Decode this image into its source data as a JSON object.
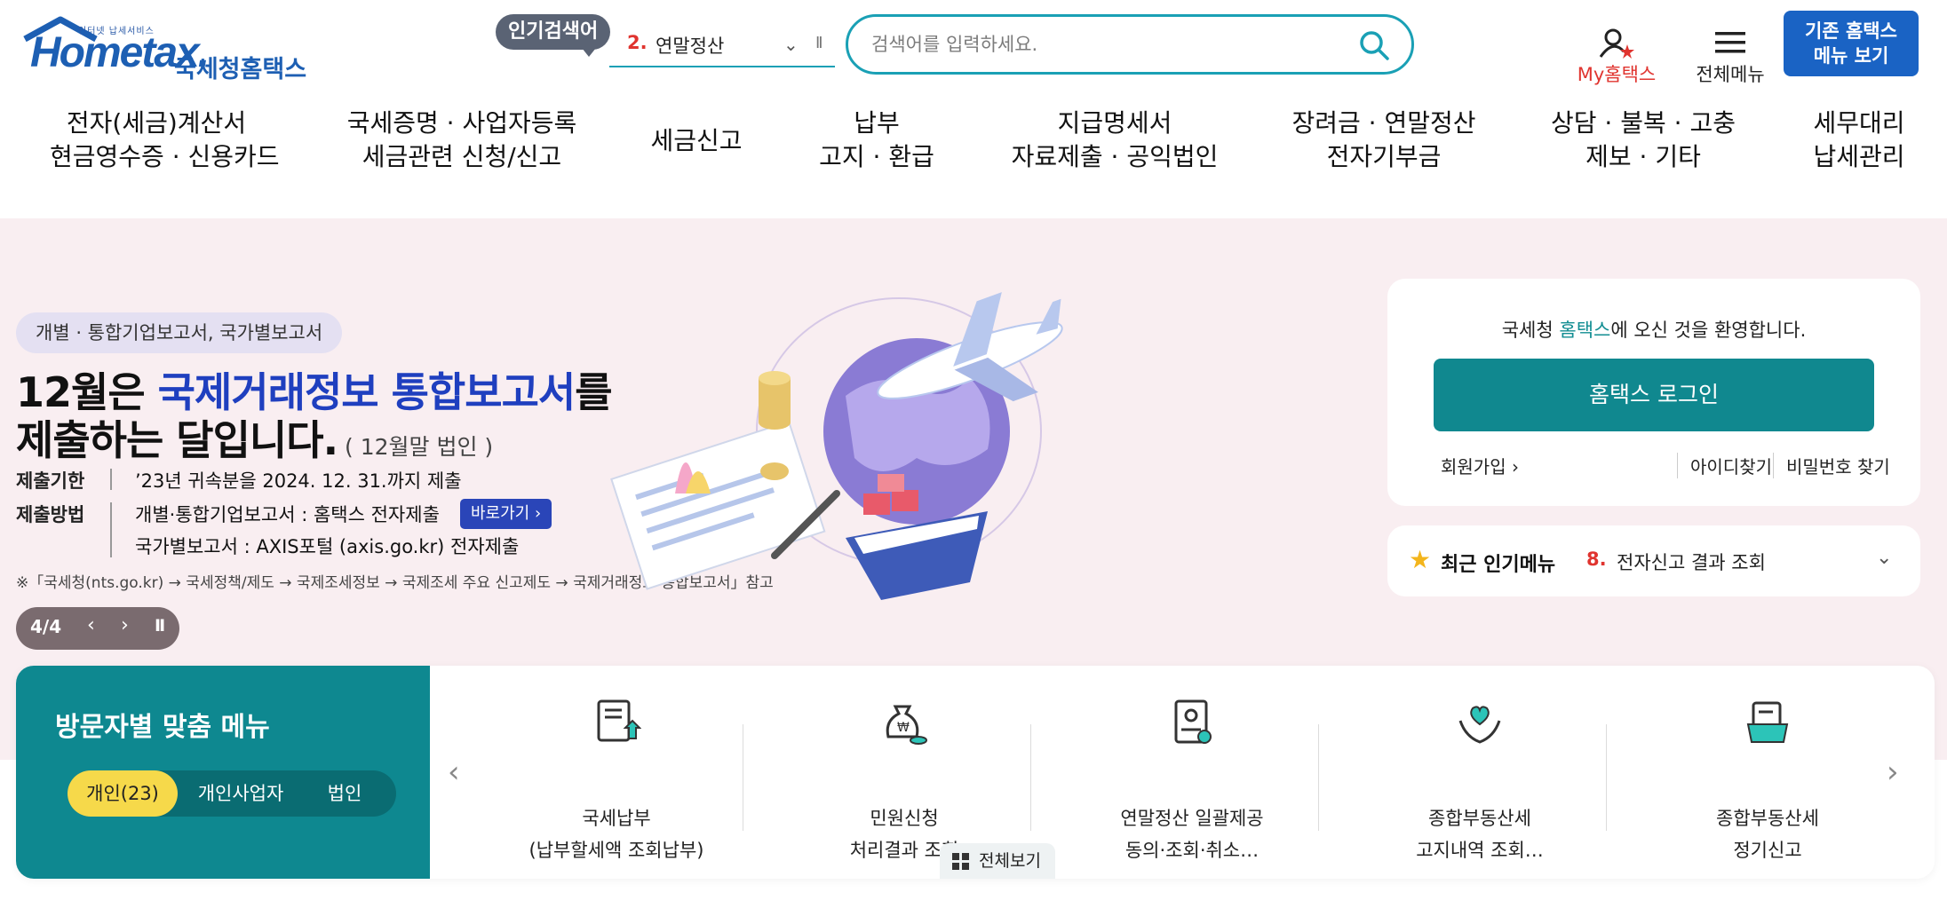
{
  "header": {
    "logo": {
      "small_text": "인터넷 납세서비스",
      "main": "Hometax.",
      "korean": "국세청홈택스"
    },
    "popular": {
      "tag": "인기검색어",
      "rank": "2.",
      "keyword": "연말정산"
    },
    "search": {
      "placeholder": "검색어를 입력하세요."
    },
    "my_hometax": "My홈택스",
    "all_menu": "전체메뉴",
    "legacy": {
      "line1": "기존 홈택스",
      "line2": "메뉴 보기"
    }
  },
  "nav": [
    {
      "line1": "전자(세금)계산서",
      "line2": "현금영수증 · 신용카드"
    },
    {
      "line1": "국세증명 · 사업자등록",
      "line2": "세금관련 신청/신고"
    },
    {
      "line1": "세금신고",
      "line2": ""
    },
    {
      "line1": "납부",
      "line2": "고지 · 환급"
    },
    {
      "line1": "지급명세서",
      "line2": "자료제출 · 공익법인"
    },
    {
      "line1": "장려금 · 연말정산",
      "line2": "전자기부금"
    },
    {
      "line1": "상담 · 불복 · 고충",
      "line2": "제보 · 기타"
    },
    {
      "line1": "세무대리",
      "line2": "납세관리"
    }
  ],
  "banner": {
    "badge": "개별 · 통합기업보고서, 국가별보고서",
    "headline_pre": "12월은 ",
    "headline_hl": "국제거래정보 통합보고서",
    "headline_post": "를",
    "headline2": "제출하는 달입니다.",
    "headline2_note": " ( 12월말 법인 )",
    "deadline_label": "제출기한",
    "deadline_value": "’23년 귀속분을 2024. 12. 31.까지 제출",
    "method_label": "제출방법",
    "method_value1": "개별·통합기업보고서 : 홈택스 전자제출",
    "go_button": "바로가기 ›",
    "method_value2": "국가별보고서 : AXIS포털 (axis.go.kr) 전자제출",
    "footnote": "※「국세청(nts.go.kr) → 국세정책/제도 → 국제조세정보 → 국제조세 주요 신고제도 → 국제거래정보 통합보고서」참고",
    "pager": {
      "current": "4/4",
      "prev": "‹",
      "next": "›",
      "pause": "II"
    }
  },
  "login": {
    "welcome_pre": "국세청 ",
    "welcome_brand": "홈택스",
    "welcome_post": "에 오신 것을 환영합니다.",
    "login_button": "홈택스 로그인",
    "signup": "회원가입 ›",
    "find_id": "아이디찾기",
    "find_pw": "비밀번호 찾기"
  },
  "recent": {
    "title": "최근 인기메뉴",
    "rank": "8.",
    "item": "전자신고 결과 조회"
  },
  "visitor": {
    "title": "방문자별 맞춤 메뉴",
    "tabs": [
      "개인(23)",
      "개인사업자",
      "법인"
    ],
    "services": [
      {
        "icon": "tax-payment-icon",
        "line1": "국세납부",
        "line2": "(납부할세액 조회납부)"
      },
      {
        "icon": "money-bag-icon",
        "line1": "민원신청",
        "line2": "처리결과 조회"
      },
      {
        "icon": "certificate-icon",
        "line1": "연말정산 일괄제공",
        "line2": "동의·조회·취소…"
      },
      {
        "icon": "heart-hands-icon",
        "line1": "종합부동산세",
        "line2": "고지내역 조회…"
      },
      {
        "icon": "folder-document-icon",
        "line1": "종합부동산세",
        "line2": "정기신고"
      }
    ],
    "see_all": "전체보기"
  },
  "colors": {
    "accent": "#1aa0b5",
    "teal": "#0e8890",
    "brand_blue": "#1d5fb3",
    "banner_bg": "#f9eef1",
    "highlight_yellow": "#f6d94a",
    "red": "#e0342f"
  }
}
